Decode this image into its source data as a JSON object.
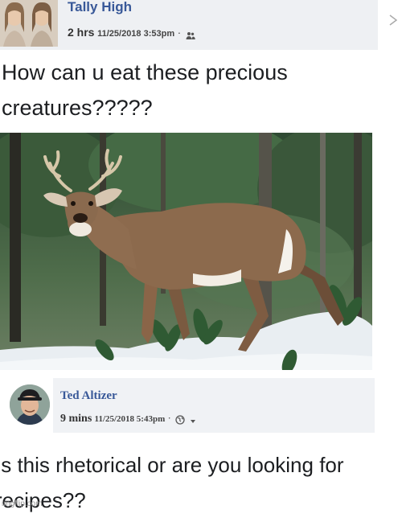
{
  "post": {
    "author": "Tally High",
    "relative_time": "2 hrs",
    "timestamp": "11/25/2018 3:53pm",
    "separator": "·",
    "audience_icon": "friends-icon",
    "text": "How can u eat these precious creatures?????"
  },
  "photo": {
    "subject": "deer-in-snowy-forest"
  },
  "comment": {
    "author": "Ted Altizer",
    "relative_time": "9 mins",
    "timestamp": "11/25/2018 5:43pm",
    "separator": "·",
    "audience_icon": "globe-icon",
    "dropdown_icon": "caret-down-icon",
    "text": "Is this rhetorical or are you looking for recipes??"
  },
  "watermark": "imgflip.com",
  "colors": {
    "name_link": "#385898",
    "header_bg": "#eef0f3",
    "comment_bg": "#f0f2f5"
  }
}
